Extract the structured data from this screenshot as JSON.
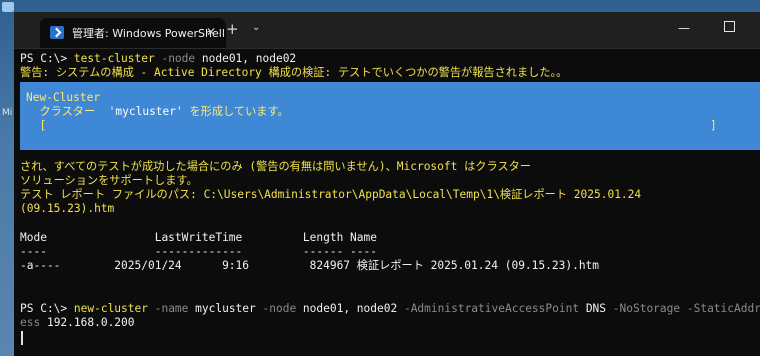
{
  "desktop": {
    "label": "Mi"
  },
  "window": {
    "tab_title": "管理者: Windows PowerShell",
    "tab_close": "✕",
    "new_tab": "+",
    "dropdown": "⌄",
    "minimize": "—"
  },
  "terminal": {
    "line1_prompt": "PS C:\\> ",
    "line1_cmd": "test-cluster",
    "line1_args": " -node ",
    "line1_rest": "node01, node02",
    "warning": "警告: システムの構成 - Active Directory 構成の検証: テストでいくつかの警告が報告されました。。",
    "progress_title": "New-Cluster",
    "progress_msg_prefix": "  クラスター  ",
    "progress_msg_name": "'mycluster'",
    "progress_msg_suffix": " を形成しています。",
    "progress_bar_open": "  [",
    "progress_bar_close": "]",
    "info1": "され、すべてのテストが成功した場合にのみ (警告の有無は問いません)、Microsoft はクラスター",
    "info2": "ソリューションをサポートします。",
    "info3": "テスト レポート ファイルのパス: C:\\Users\\Administrator\\AppData\\Local\\Temp\\1\\検証レポート 2025.01.24",
    "info4": "(09.15.23).htm",
    "table_header": "Mode                LastWriteTime         Length Name",
    "table_sep": "----                -------------         ------ ----",
    "table_row": "-a----        2025/01/24      9:16         824967 検証レポート 2025.01.24 (09.15.23).htm",
    "cmd2_prompt": "PS C:\\> ",
    "cmd2_cmd": "new-cluster",
    "cmd2_p1": " -name ",
    "cmd2_v1": "mycluster",
    "cmd2_p2": " -node ",
    "cmd2_v2": "node01, node02",
    "cmd2_p3": " -AdministrativeAccessPoint ",
    "cmd2_v3": "DNS",
    "cmd2_p4": " -NoStorage -StaticAddr",
    "cmd2_wrap_p": "ess",
    "cmd2_wrap_v": " 192.168.0.200"
  }
}
